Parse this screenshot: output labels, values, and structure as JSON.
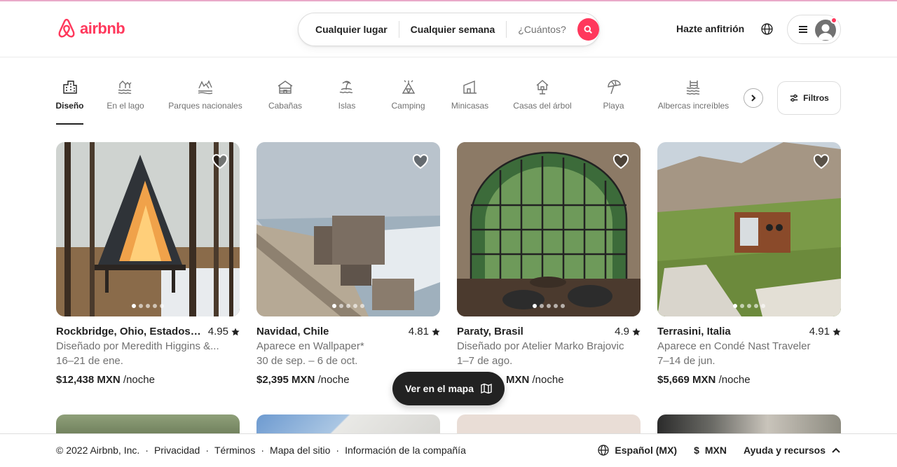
{
  "brand": {
    "logo_text": "airbnb",
    "color": "#FF385C"
  },
  "search": {
    "location": "Cualquier lugar",
    "week": "Cualquier semana",
    "guests": "¿Cuántos?"
  },
  "header": {
    "host_link": "Hazte anfitrión"
  },
  "categories": [
    {
      "label": "Diseño",
      "icon": "design-icon",
      "active": true
    },
    {
      "label": "En el lago",
      "icon": "lake-icon"
    },
    {
      "label": "Parques nacionales",
      "icon": "national-park-icon"
    },
    {
      "label": "Cabañas",
      "icon": "cabin-icon"
    },
    {
      "label": "Islas",
      "icon": "island-icon"
    },
    {
      "label": "Camping",
      "icon": "camping-icon"
    },
    {
      "label": "Minicasas",
      "icon": "tiny-house-icon"
    },
    {
      "label": "Casas del árbol",
      "icon": "treehouse-icon"
    },
    {
      "label": "Playa",
      "icon": "beach-icon"
    },
    {
      "label": "Albercas increíbles",
      "icon": "pool-icon"
    }
  ],
  "filters": {
    "label": "Filtros"
  },
  "listings": [
    {
      "title": "Rockbridge, Ohio, Estados ...",
      "rating": "4.95",
      "subtitle": "Diseñado por Meredith Higgins &...",
      "dates": "16–21 de ene.",
      "price": "$12,438 MXN",
      "unit": "/noche"
    },
    {
      "title": "Navidad, Chile",
      "rating": "4.81",
      "subtitle": "Aparece en Wallpaper*",
      "dates": "30 de sep. – 6 de oct.",
      "price": "$2,395 MXN",
      "unit": "/noche"
    },
    {
      "title": "Paraty, Brasil",
      "rating": "4.9",
      "subtitle": "Diseñado por Atelier Marko Brajovic",
      "dates": "1–7 de ago.",
      "price": "MXN",
      "unit": "/noche"
    },
    {
      "title": "Terrasini, Italia",
      "rating": "4.91",
      "subtitle": "Aparece en Condé Nast Traveler",
      "dates": "7–14 de jun.",
      "price": "$5,669 MXN",
      "unit": "/noche"
    }
  ],
  "map_button": {
    "label": "Ver en el mapa"
  },
  "footer": {
    "copyright": "© 2022 Airbnb, Inc.",
    "sep": "·",
    "links": [
      "Privacidad",
      "Términos",
      "Mapa del sitio",
      "Información de la compañía"
    ],
    "language": "Español (MX)",
    "currency_symbol": "$",
    "currency": "MXN",
    "help": "Ayuda y recursos"
  }
}
